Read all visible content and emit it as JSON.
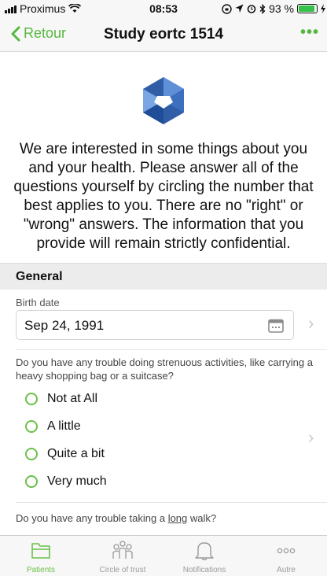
{
  "status_bar": {
    "carrier": "Proximus",
    "time": "08:53",
    "battery": "93 %",
    "battery_level": 0.93,
    "colors": {
      "battery_fill": "#36c14a"
    }
  },
  "nav": {
    "back_label": "Retour",
    "title": "Study eortc 1514",
    "more_label": "•••",
    "accent": "#55b83f"
  },
  "intro": {
    "text": "We are interested in some things about you and your health. Please answer all of the questions yourself by circling the number that best applies to you. There are no \"right\" or \"wrong\" answers. The information that you provide will remain strictly confidential."
  },
  "section": {
    "title": "General"
  },
  "birth_date": {
    "label": "Birth date",
    "value": "Sep 24, 1991",
    "icon": "calendar-icon"
  },
  "question1": {
    "text": "Do you have any trouble doing strenuous activities, like carrying a heavy shopping bag or a suitcase?",
    "options": [
      "Not at All",
      "A little",
      "Quite a bit",
      "Very much"
    ]
  },
  "question2": {
    "prefix": "Do you have any trouble taking a ",
    "emphasis": "long",
    "suffix": " walk?"
  },
  "tab_bar": {
    "tabs": [
      {
        "label": "Patients",
        "icon": "folder-icon",
        "active": true
      },
      {
        "label": "Circle of trust",
        "icon": "people-icon",
        "active": false
      },
      {
        "label": "Notifications",
        "icon": "bell-icon",
        "active": false
      },
      {
        "label": "Autre",
        "icon": "more-icon",
        "active": false
      }
    ],
    "active_color": "#6cc04a",
    "inactive_color": "#9a9a9a"
  }
}
